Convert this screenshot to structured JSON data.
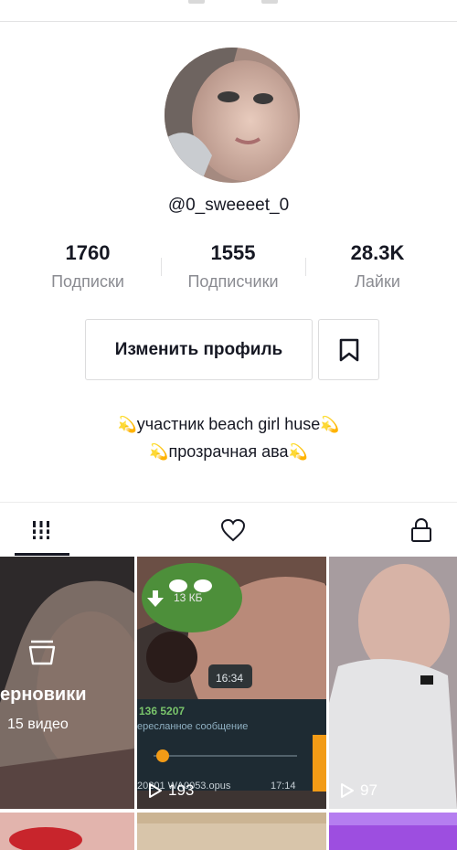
{
  "profile": {
    "username": "@0_sweeeet_0"
  },
  "stats": [
    {
      "value": "1760",
      "label": "Подписки"
    },
    {
      "value": "1555",
      "label": "Подписчики"
    },
    {
      "value": "28.3K",
      "label": "Лайки"
    }
  ],
  "actions": {
    "edit_profile_label": "Изменить профиль"
  },
  "bio": {
    "line1": "участник beach girl huse",
    "line2": "прозрачная ава"
  },
  "tabs": [
    {
      "name": "videos",
      "icon": "grid-icon",
      "active": true
    },
    {
      "name": "liked",
      "icon": "heart-icon",
      "active": false
    },
    {
      "name": "private",
      "icon": "lock-icon",
      "active": false
    }
  ],
  "grid": {
    "drafts": {
      "label": "ерновики",
      "count": "15 видео"
    },
    "videos": [
      {
        "views": "193",
        "overlay": {
          "file_size": "13 КБ",
          "time": "16:34",
          "number": "136 5207",
          "caption": "ересланное сообщение",
          "filename": "20201 WA0053.opus",
          "timestamp": "17:14"
        }
      },
      {
        "views": "97"
      }
    ]
  },
  "colors": {
    "text": "#161823",
    "secondary": "#8a8b91",
    "border": "#dcdcdd",
    "accent_orange": "#f29b16"
  }
}
